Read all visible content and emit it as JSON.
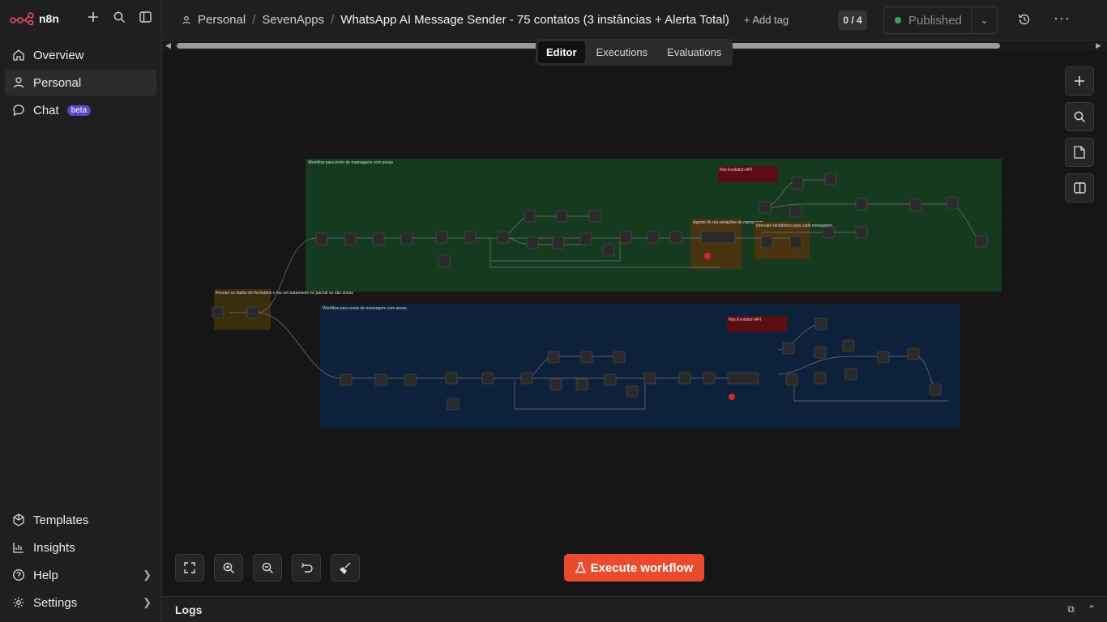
{
  "sidebar": {
    "logo_text": "n8n",
    "items": [
      {
        "label": "Overview"
      },
      {
        "label": "Personal"
      },
      {
        "label": "Chat",
        "badge": "beta"
      }
    ],
    "bottom": [
      {
        "label": "Templates"
      },
      {
        "label": "Insights"
      },
      {
        "label": "Help"
      },
      {
        "label": "Settings"
      }
    ]
  },
  "header": {
    "breadcrumb": [
      "Personal",
      "SevenApps"
    ],
    "title": "WhatsApp AI Message Sender - 75 contatos (3 instâncias + Alerta Total)",
    "add_tag": "+ Add tag",
    "counter": "0 / 4",
    "status": "Published"
  },
  "tabs": [
    "Editor",
    "Executions",
    "Evaluations"
  ],
  "canvas": {
    "sticky_top_title": "Workflow para envio de mensagens com ansas",
    "sticky_bottom_title": "Workflow para envio de mensagem com ansas",
    "sticky_left": "Recebe os dados do formulário e faz um tratamento no parcial ou não ansas",
    "note_red_top": "Nós Evolution API",
    "note_red_bottom": "Nós Evolution API",
    "note_agent": "Agente IA cria variações de mensagem",
    "note_interval": "Intervalo randômico para cada mensagem"
  },
  "footer": {
    "execute_label": "Execute workflow",
    "logs_label": "Logs"
  },
  "colors": {
    "accent": "#ea4b2e",
    "published_dot": "#3ba55c",
    "beta": "#5a48c9"
  }
}
